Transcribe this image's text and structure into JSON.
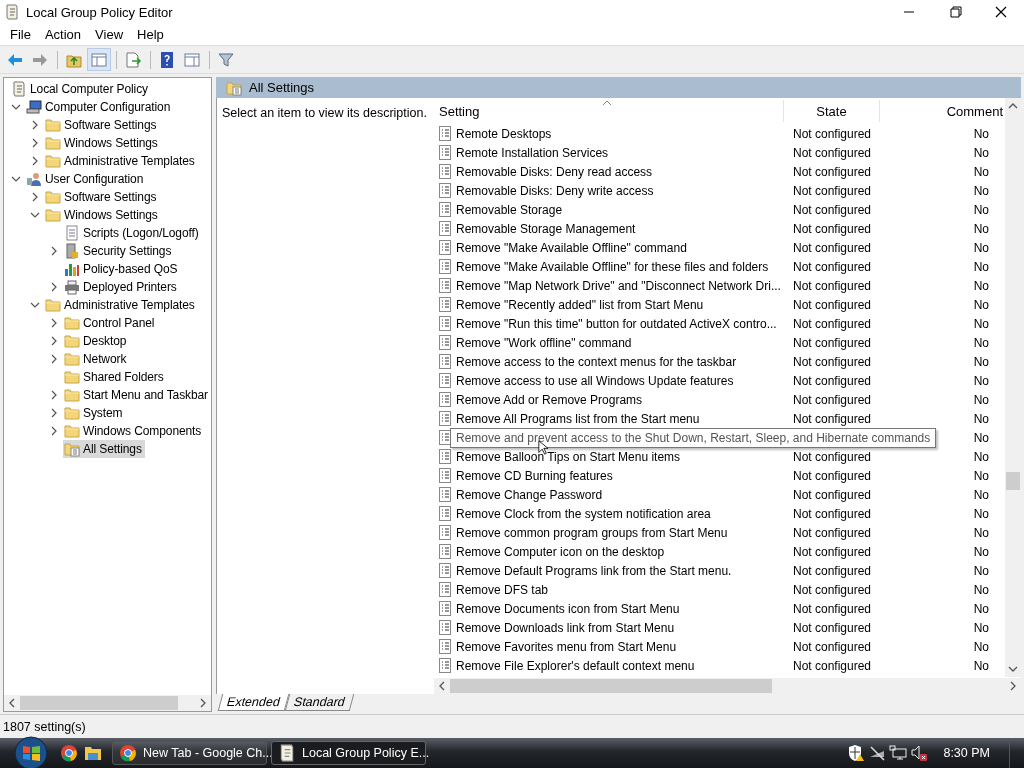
{
  "window": {
    "title": "Local Group Policy Editor"
  },
  "menu": [
    "File",
    "Action",
    "View",
    "Help"
  ],
  "toolbar": [
    {
      "kind": "back",
      "disabled": false
    },
    {
      "kind": "forward",
      "disabled": true
    },
    {
      "kind": "up"
    },
    {
      "kind": "tree",
      "selected": true
    },
    {
      "kind": "export"
    },
    {
      "kind": "help"
    },
    {
      "kind": "pane"
    },
    {
      "kind": "filter"
    }
  ],
  "tree": [
    {
      "label": "Local Computer Policy",
      "kind": "policy",
      "selected": false,
      "children": [
        {
          "label": "Computer Configuration",
          "kind": "computer",
          "selected": false,
          "expanded": true,
          "children": [
            {
              "label": "Software Settings",
              "kind": "folder",
              "selected": false,
              "expanded": false
            },
            {
              "label": "Windows Settings",
              "kind": "folder",
              "selected": false,
              "expanded": false
            },
            {
              "label": "Administrative Templates",
              "kind": "folder",
              "selected": false,
              "expanded": false
            }
          ]
        },
        {
          "label": "User Configuration",
          "kind": "user",
          "selected": false,
          "expanded": true,
          "children": [
            {
              "label": "Software Settings",
              "kind": "folder",
              "selected": false,
              "expanded": false
            },
            {
              "label": "Windows Settings",
              "kind": "folder",
              "selected": false,
              "expanded": true,
              "children": [
                {
                  "label": "Scripts (Logon/Logoff)",
                  "kind": "script",
                  "selected": false
                },
                {
                  "label": "Security Settings",
                  "kind": "security",
                  "selected": false,
                  "expanded": false
                },
                {
                  "label": "Policy-based QoS",
                  "kind": "qos",
                  "selected": false
                },
                {
                  "label": "Deployed Printers",
                  "kind": "printer",
                  "selected": false,
                  "expanded": false
                }
              ]
            },
            {
              "label": "Administrative Templates",
              "kind": "folder",
              "selected": false,
              "expanded": true,
              "children": [
                {
                  "label": "Control Panel",
                  "kind": "folder",
                  "selected": false,
                  "expanded": false
                },
                {
                  "label": "Desktop",
                  "kind": "folder",
                  "selected": false,
                  "expanded": false
                },
                {
                  "label": "Network",
                  "kind": "folder",
                  "selected": false,
                  "expanded": false
                },
                {
                  "label": "Shared Folders",
                  "kind": "folder",
                  "selected": false
                },
                {
                  "label": "Start Menu and Taskbar",
                  "kind": "folder",
                  "selected": false,
                  "expanded": false
                },
                {
                  "label": "System",
                  "kind": "folder",
                  "selected": false,
                  "expanded": false
                },
                {
                  "label": "Windows Components",
                  "kind": "folder",
                  "selected": false,
                  "expanded": false
                },
                {
                  "label": "All Settings",
                  "kind": "settings",
                  "selected": true
                }
              ]
            }
          ]
        }
      ]
    }
  ],
  "details": {
    "title": "All Settings",
    "description": "Select an item to view its description."
  },
  "table": {
    "columns": [
      "Setting",
      "State",
      "Comment"
    ],
    "rows": [
      {
        "setting": "Remote Desktops",
        "state": "Not configured",
        "comment": "No"
      },
      {
        "setting": "Remote Installation Services",
        "state": "Not configured",
        "comment": "No"
      },
      {
        "setting": "Removable Disks: Deny read access",
        "state": "Not configured",
        "comment": "No"
      },
      {
        "setting": "Removable Disks: Deny write access",
        "state": "Not configured",
        "comment": "No"
      },
      {
        "setting": "Removable Storage",
        "state": "Not configured",
        "comment": "No"
      },
      {
        "setting": "Removable Storage Management",
        "state": "Not configured",
        "comment": "No"
      },
      {
        "setting": "Remove \"Make Available Offline\" command",
        "state": "Not configured",
        "comment": "No"
      },
      {
        "setting": "Remove \"Make Available Offline\" for these files and folders",
        "state": "Not configured",
        "comment": "No"
      },
      {
        "setting": "Remove \"Map Network Drive\" and \"Disconnect Network Dri...",
        "state": "Not configured",
        "comment": "No"
      },
      {
        "setting": "Remove \"Recently added\" list from Start Menu",
        "state": "Not configured",
        "comment": "No"
      },
      {
        "setting": "Remove \"Run this time\" button for outdated ActiveX contro...",
        "state": "Not configured",
        "comment": "No"
      },
      {
        "setting": "Remove \"Work offline\" command",
        "state": "Not configured",
        "comment": "No"
      },
      {
        "setting": "Remove access to the context menus for the taskbar",
        "state": "Not configured",
        "comment": "No"
      },
      {
        "setting": "Remove access to use all Windows Update features",
        "state": "Not configured",
        "comment": "No"
      },
      {
        "setting": "Remove Add or Remove Programs",
        "state": "Not configured",
        "comment": "No"
      },
      {
        "setting": "Remove All Programs list from the Start menu",
        "state": "Not configured",
        "comment": "No"
      },
      {
        "tooltip": "Remove and prevent access to the Shut Down, Restart, Sleep, and Hibernate commands",
        "comment": "No"
      },
      {
        "setting": "Remove Balloon Tips on Start Menu items",
        "state": "Not configured",
        "comment": "No"
      },
      {
        "setting": "Remove CD Burning features",
        "state": "Not configured",
        "comment": "No"
      },
      {
        "setting": "Remove Change Password",
        "state": "Not configured",
        "comment": "No"
      },
      {
        "setting": "Remove Clock from the system notification area",
        "state": "Not configured",
        "comment": "No"
      },
      {
        "setting": "Remove common program groups from Start Menu",
        "state": "Not configured",
        "comment": "No"
      },
      {
        "setting": "Remove Computer icon on the desktop",
        "state": "Not configured",
        "comment": "No"
      },
      {
        "setting": "Remove Default Programs link from the Start menu.",
        "state": "Not configured",
        "comment": "No"
      },
      {
        "setting": "Remove DFS tab",
        "state": "Not configured",
        "comment": "No"
      },
      {
        "setting": "Remove Documents icon from Start Menu",
        "state": "Not configured",
        "comment": "No"
      },
      {
        "setting": "Remove Downloads link from Start Menu",
        "state": "Not configured",
        "comment": "No"
      },
      {
        "setting": "Remove Favorites menu from Start Menu",
        "state": "Not configured",
        "comment": "No"
      },
      {
        "setting": "Remove File Explorer's default context menu",
        "state": "Not configured",
        "comment": "No"
      }
    ]
  },
  "view_tabs": [
    {
      "label": "Extended",
      "selected": true
    },
    {
      "label": "Standard",
      "selected": false
    }
  ],
  "status_bar": "1807 setting(s)",
  "taskbar": {
    "pinned": [
      {
        "kind": "browser"
      },
      {
        "kind": "folder"
      }
    ],
    "tasks": [
      {
        "label": "New Tab - Google Ch...",
        "kind": "browser",
        "selected": false
      },
      {
        "label": "Local Group Policy E...",
        "kind": "policy",
        "selected": true
      }
    ],
    "clock": "8:30 PM"
  }
}
